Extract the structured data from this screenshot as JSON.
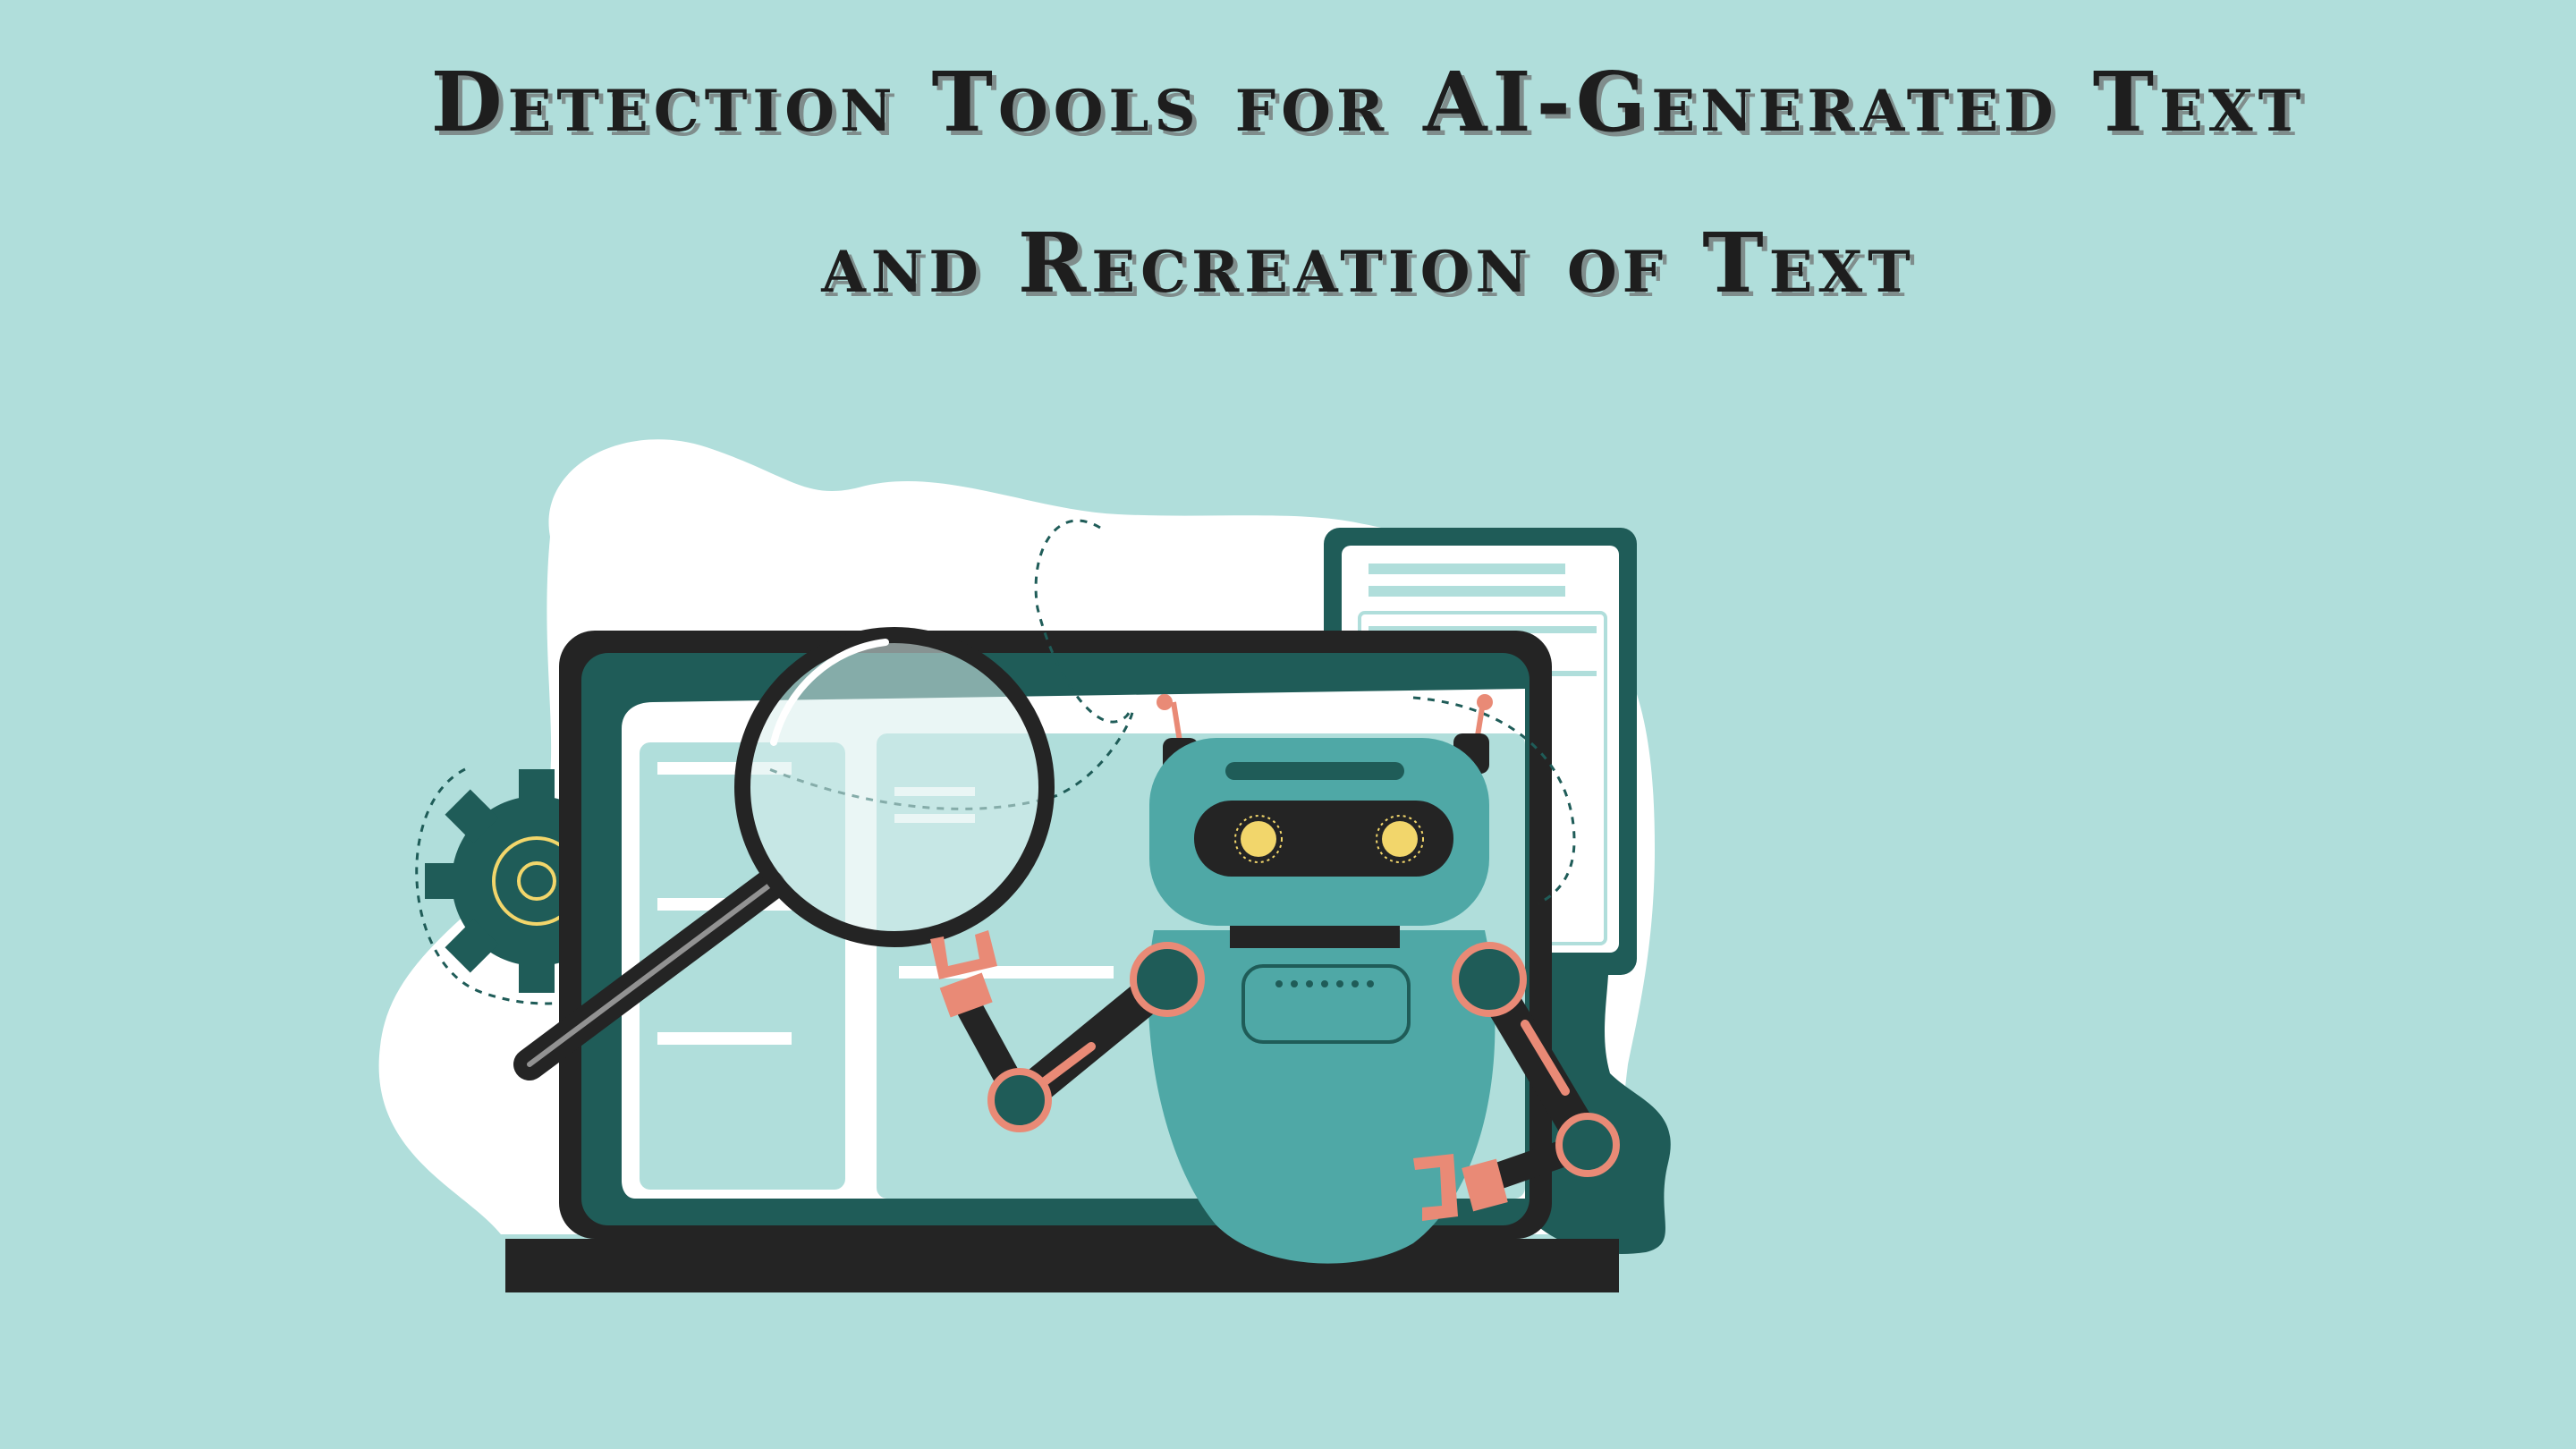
{
  "title": {
    "line1": "Detection Tools for AI-Generated Text",
    "line2": "and Recreation of Text"
  },
  "icons": {
    "laptop": "laptop-icon",
    "robot": "robot-icon",
    "magnifier": "magnifying-glass-icon",
    "gear": "gear-icon",
    "document": "document-icon"
  },
  "colors": {
    "background": "#b0dedb",
    "dark_teal": "#1f5c58",
    "robot_teal": "#4fa8a6",
    "laptop_dark": "#242424",
    "accent_salmon": "#e98a76",
    "eye_yellow": "#f2d66b"
  }
}
